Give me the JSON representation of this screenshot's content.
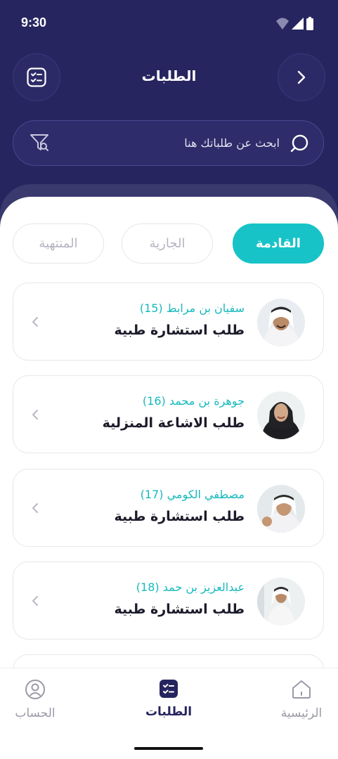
{
  "status_bar": {
    "time": "9:30",
    "icons": [
      "wifi-icon",
      "signal-icon",
      "battery-icon"
    ]
  },
  "header": {
    "title": "الطلبات",
    "left_icon": "checklist-icon",
    "right_icon": "chevron-right-icon"
  },
  "search": {
    "placeholder": "ابحث عن طلباتك هنا",
    "value": "",
    "icon": "search-icon",
    "filter_icon": "filter-icon"
  },
  "tabs": [
    {
      "label": "القادمة",
      "active": true
    },
    {
      "label": "الجارية",
      "active": false
    },
    {
      "label": "المنتهية",
      "active": false
    }
  ],
  "requests": [
    {
      "name": "سفيان بن مرابط (15)",
      "title": "طلب استشارة طبية"
    },
    {
      "name": "جوهرة بن محمد (16)",
      "title": "طلب الاشاعة المنزلية"
    },
    {
      "name": "مصطفي الكومي (17)",
      "title": "طلب استشارة طبية"
    },
    {
      "name": "عبدالعزيز بن حمد (18)",
      "title": "طلب استشارة طبية"
    }
  ],
  "bottom_nav": [
    {
      "label": "الرئيسية",
      "icon": "home-icon",
      "active": false
    },
    {
      "label": "الطلبات",
      "icon": "checklist-icon",
      "active": true
    },
    {
      "label": "الحساب",
      "icon": "user-icon",
      "active": false
    }
  ],
  "colors": {
    "primary_dark": "#27255f",
    "accent_teal": "#17c3c7",
    "name_teal": "#17b9bd",
    "text_dark": "#1b1b2a",
    "muted": "#9a9aa8"
  }
}
